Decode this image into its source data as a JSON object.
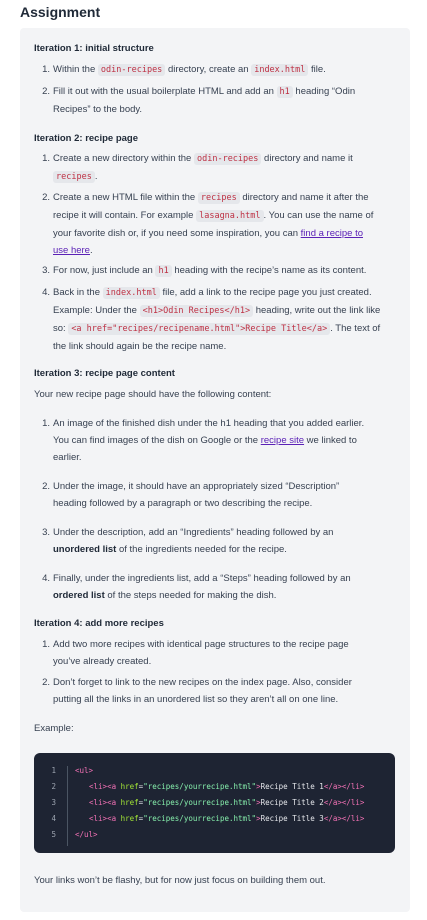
{
  "title": "Assignment",
  "iter1": {
    "title": "Iteration 1: initial structure",
    "items": [
      {
        "n": "1.",
        "a": "Within the ",
        "code": "odin-recipes",
        "b": " directory, create an ",
        "code2": "index.html",
        "c": " file."
      },
      {
        "n": "2.",
        "a": "Fill it out with the usual boilerplate HTML and add an ",
        "code": "h1",
        "b": " heading “Odin",
        "c": "Recipes” to the body."
      }
    ]
  },
  "iter2": {
    "title": "Iteration 2: recipe page",
    "i1": {
      "n": "1.",
      "a": "Create a new directory within the ",
      "code": "odin-recipes",
      "b": " directory and name it",
      "code2": "recipes",
      "c": "."
    },
    "i2": {
      "n": "2.",
      "a": "Create a new HTML file within the ",
      "code": "recipes",
      "b": " directory and name it after the",
      "c": "recipe it will contain. For example ",
      "code2": "lasagna.html",
      "d": ". You can use the name of",
      "e": "your favorite dish or, if you need some inspiration, you can ",
      "link1": "find a recipe to",
      "link2": "use here",
      "f": "."
    },
    "i3": {
      "n": "3.",
      "a": "For now, just include an ",
      "code": "h1",
      "b": " heading with the recipe’s name as its content."
    },
    "i4": {
      "n": "4.",
      "a": "Back in the ",
      "code": "index.html",
      "b": " file, add a link to the recipe page you just created.",
      "c": "Example: Under the ",
      "code2": "<h1>Odin Recipes</h1>",
      "d": " heading, write out the link like",
      "e": "so: ",
      "code3": "<a href=\"recipes/recipename.html\">Recipe Title</a>",
      "f": ". The text of",
      "g": "the link should again be the recipe name."
    }
  },
  "iter3": {
    "title": "Iteration 3: recipe page content",
    "intro": "Your new recipe page should have the following content:",
    "i1": {
      "n": "1.",
      "a": "An image of the finished dish under the h1 heading that you added earlier.",
      "b": "You can find images of the dish on Google or the ",
      "link": "recipe site",
      "c": " we linked to",
      "d": "earlier."
    },
    "i2": {
      "n": "2.",
      "a": "Under the image, it should have an appropriately sized “Description”",
      "b": "heading followed by a paragraph or two describing the recipe."
    },
    "i3": {
      "n": "3.",
      "a": "Under the description, add an “Ingredients” heading followed by an",
      "bold": "unordered list",
      "b": " of the ingredients needed for the recipe."
    },
    "i4": {
      "n": "4.",
      "a": "Finally, under the ingredients list, add a “Steps” heading followed by an",
      "bold": "ordered list",
      "b": " of the steps needed for making the dish."
    }
  },
  "iter4": {
    "title": "Iteration 4: add more recipes",
    "i1": {
      "n": "1.",
      "a": "Add two more recipes with identical page structures to the recipe page",
      "b": "you’ve already created."
    },
    "i2": {
      "n": "2.",
      "a": "Don’t forget to link to the new recipes on the index page. Also, consider",
      "b": "putting all the links in an unordered list so they aren’t all on one line."
    }
  },
  "example_label": "Example:",
  "code": {
    "line_numbers": [
      "1",
      "2",
      "3",
      "4",
      "5"
    ],
    "ul_open": "<ul>",
    "ul_close": "</ul>",
    "li_open": "<li>",
    "a_open": "<a ",
    "href_attr": "href",
    "eq": "=",
    "href1": "\"recipes/yourrecipe.html\"",
    "href2": "\"recipes/yourrecipe.html\"",
    "href3": "\"recipes/yourrecipe.html\"",
    "gt": ">",
    "text1": "Recipe Title 1",
    "text2": "Recipe Title 2",
    "text3": "Recipe Title 3",
    "a_close": "</a>",
    "li_close": "</li>"
  },
  "footer": "Your links won’t be flashy, but for now just focus on building them out.",
  "colors": {
    "card_bg": "#f3f4f6",
    "code_bg": "#1e2433",
    "inline_code": "#be3144",
    "link": "#5b21b6"
  }
}
